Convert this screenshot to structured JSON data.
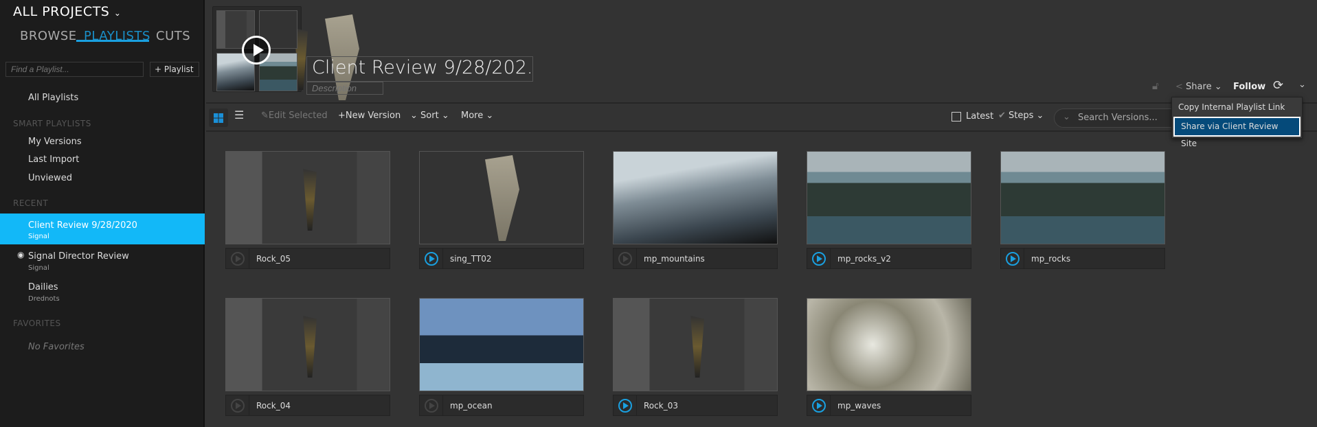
{
  "sidebar": {
    "project": "ALL PROJECTS",
    "tabs": [
      "BROWSE",
      "PLAYLISTS",
      "CUTS"
    ],
    "active_tab": "PLAYLISTS",
    "find_placeholder": "Find a Playlist...",
    "add_playlist": "+ Playlist",
    "all_playlists": "All Playlists",
    "smart_heading": "SMART PLAYLISTS",
    "smart": [
      "My Versions",
      "Last Import",
      "Unviewed"
    ],
    "recent_heading": "RECENT",
    "recent": [
      {
        "name": "Client Review 9/28/2020",
        "project": "Signal"
      },
      {
        "name": "Signal Director Review",
        "project": "Signal"
      },
      {
        "name": "Dailies",
        "project": "Drednots"
      }
    ],
    "favorites_heading": "FAVORITES",
    "no_favorites": "No Favorites"
  },
  "header": {
    "title": "Client Review 9/28/202...",
    "description_placeholder": "Description",
    "share": "Share",
    "follow": "Follow"
  },
  "share_menu": [
    "Copy Internal Playlist Link",
    "Share via Client Review Site"
  ],
  "toolbar": {
    "edit_selected": "Edit Selected",
    "new_version": "+New Version",
    "sort": "Sort",
    "more": "More",
    "latest": "Latest",
    "steps": "Steps",
    "search_placeholder": "Search Versions..."
  },
  "accent": "#12b8f8",
  "versions": [
    {
      "name": "Rock_05",
      "playable": false
    },
    {
      "name": "sing_TT02",
      "playable": true
    },
    {
      "name": "mp_mountains",
      "playable": false
    },
    {
      "name": "mp_rocks_v2",
      "playable": true
    },
    {
      "name": "mp_rocks",
      "playable": true
    },
    {
      "name": "Rock_04",
      "playable": false
    },
    {
      "name": "mp_ocean",
      "playable": false
    },
    {
      "name": "Rock_03",
      "playable": true
    },
    {
      "name": "mp_waves",
      "playable": true
    }
  ]
}
